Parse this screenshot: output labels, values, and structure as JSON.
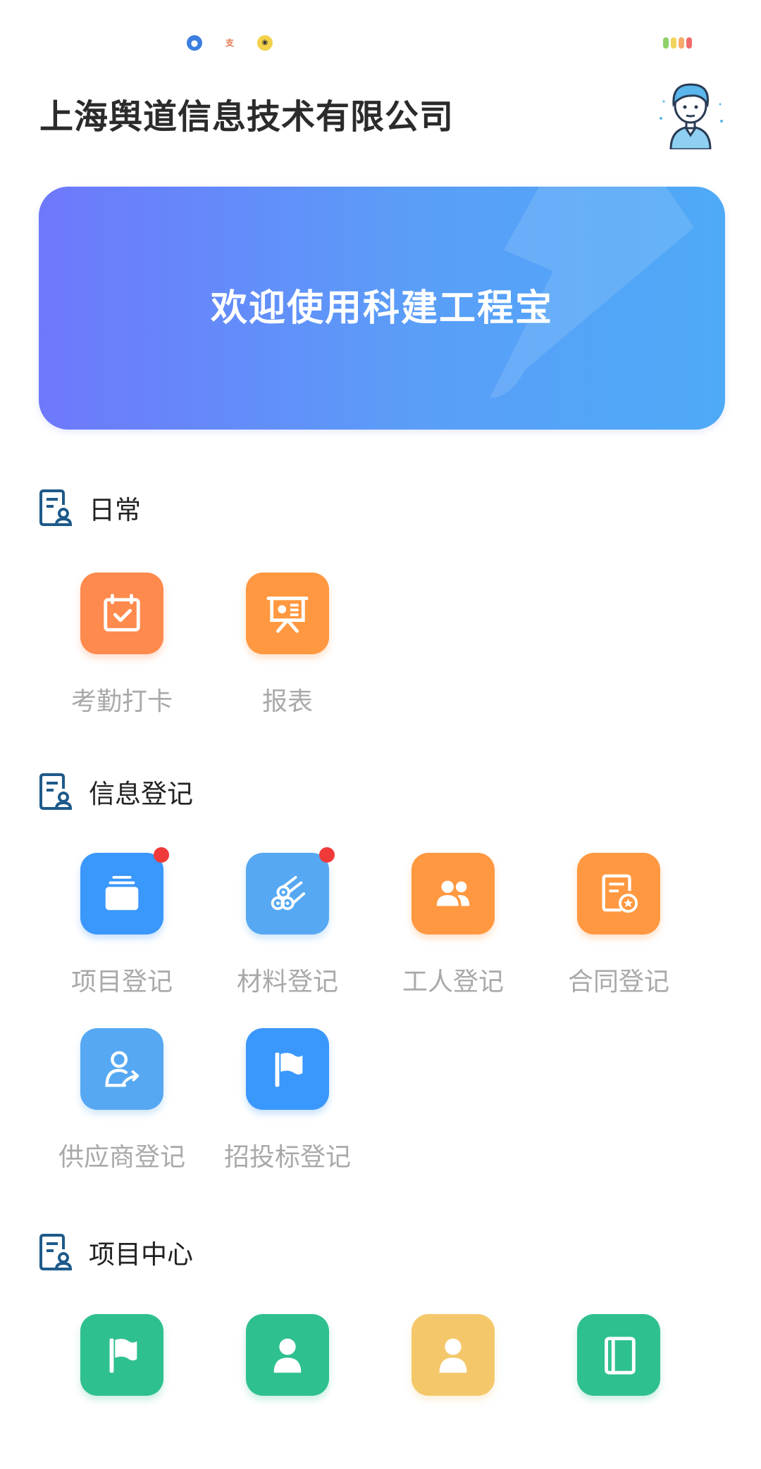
{
  "status_bar": {
    "icons": [
      "browser-icon",
      "app-icon",
      "face-icon"
    ],
    "indicator_colors": [
      "#8fd16a",
      "#f2d35b",
      "#f6a96a",
      "#ef6b6b"
    ]
  },
  "header": {
    "company_name": "上海舆道信息技术有限公司"
  },
  "banner": {
    "title": "欢迎使用科建工程宝",
    "gradient_start": "#6e78fb",
    "gradient_end": "#4eaaf7"
  },
  "sections": [
    {
      "title": "日常",
      "items": [
        {
          "label": "考勤打卡",
          "icon": "calendar-check-icon",
          "color": "#ff8a4d",
          "badge": false
        },
        {
          "label": "报表",
          "icon": "presentation-board-icon",
          "color": "#ff9840",
          "badge": false
        }
      ]
    },
    {
      "title": "信息登记",
      "items": [
        {
          "label": "项目登记",
          "icon": "folder-stack-icon",
          "color": "#3a97fb",
          "badge": true
        },
        {
          "label": "材料登记",
          "icon": "pipes-icon",
          "color": "#56a8f2",
          "badge": true
        },
        {
          "label": "工人登记",
          "icon": "people-icon",
          "color": "#ff9840",
          "badge": false
        },
        {
          "label": "合同登记",
          "icon": "contract-star-icon",
          "color": "#ff9840",
          "badge": false
        },
        {
          "label": "供应商登记",
          "icon": "person-share-icon",
          "color": "#56a8f2",
          "badge": false
        },
        {
          "label": "招投标登记",
          "icon": "flag-icon",
          "color": "#3a97fb",
          "badge": false
        }
      ]
    },
    {
      "title": "项目中心",
      "items": [
        {
          "label": "",
          "icon": "flag-icon",
          "color": "#2fc08f",
          "badge": false
        },
        {
          "label": "",
          "icon": "person-icon",
          "color": "#2fc08f",
          "badge": false
        },
        {
          "label": "",
          "icon": "person-icon",
          "color": "#f4c86a",
          "badge": false
        },
        {
          "label": "",
          "icon": "notebook-icon",
          "color": "#2fc08f",
          "badge": false
        }
      ]
    }
  ]
}
